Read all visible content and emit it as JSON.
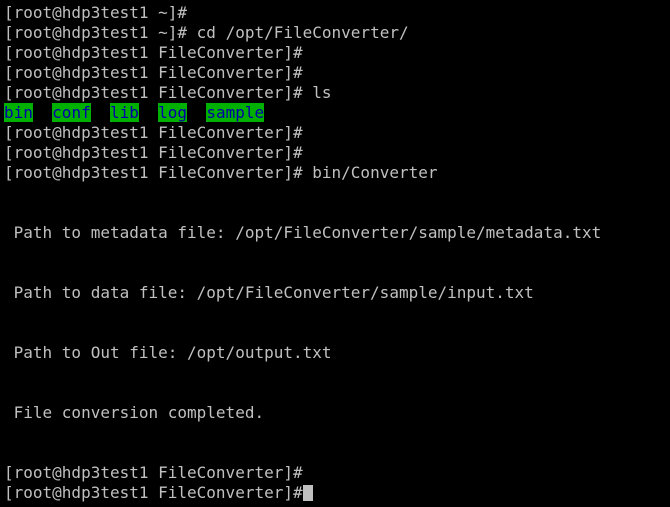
{
  "prompt": "[root@hdp3test1 ~]#",
  "prompt_fc": "[root@hdp3test1 FileConverter]#",
  "commands": {
    "cd": "cd /opt/FileConverter/",
    "ls": "ls",
    "run": "bin/Converter"
  },
  "ls_output": [
    "bin",
    "conf",
    "lib",
    "log",
    "sample"
  ],
  "output": {
    "metadata": " Path to metadata file: /opt/FileConverter/sample/metadata.txt",
    "data": " Path to data file: /opt/FileConverter/sample/input.txt",
    "out": " Path to Out file: /opt/output.txt",
    "done": " File conversion completed."
  },
  "colors": {
    "background": "#000000",
    "text": "#c0c0c0",
    "dir_background": "#00b000",
    "dir_text": "#0000aa"
  }
}
